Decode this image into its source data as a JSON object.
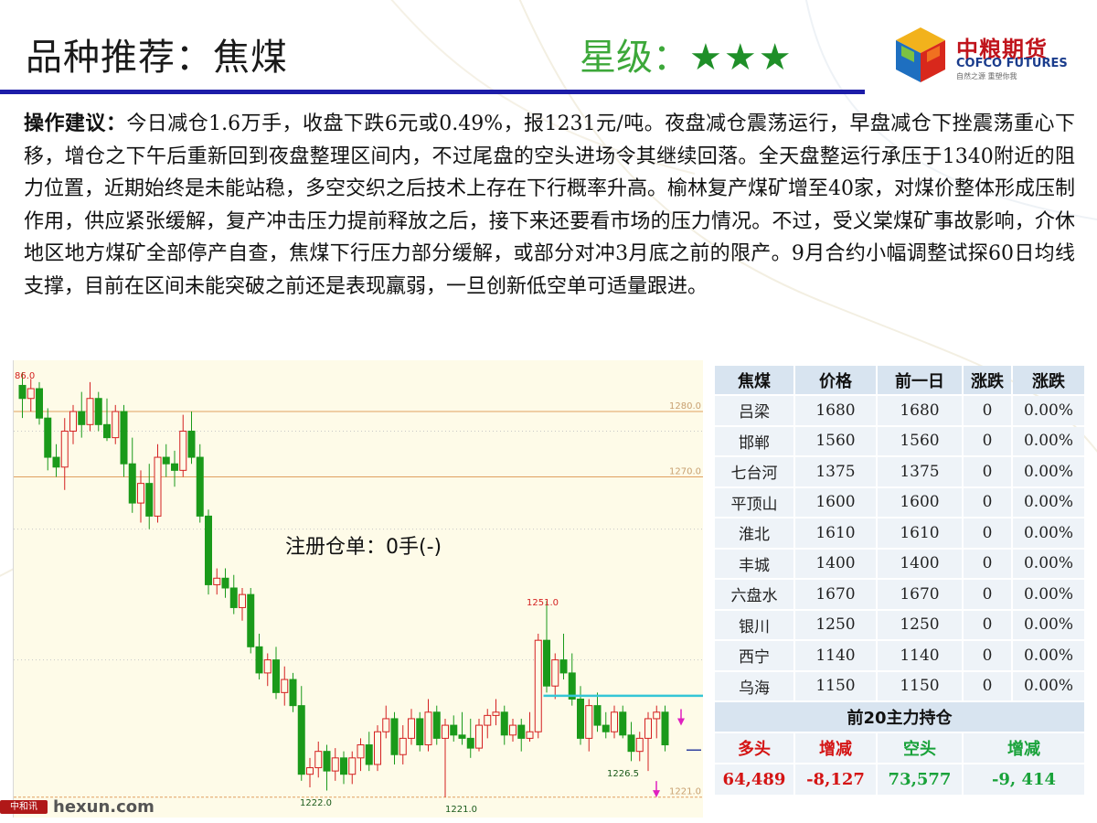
{
  "header": {
    "title": "品种推荐：焦煤",
    "rating_label": "星级：",
    "rating_stars": "★★★",
    "rating_value": 3
  },
  "logo": {
    "cn": "中粮期货",
    "en": "COFCO FUTURES",
    "tagline": "自然之源 重塑你我"
  },
  "advice": {
    "label": "操作建议：",
    "text": "今日减仓1.6万手，收盘下跌6元或0.49%，报1231元/吨。夜盘减仓震荡运行，早盘减仓下挫震荡重心下移，增仓之下午后重新回到夜盘整理区间内，不过尾盘的空头进场令其继续回落。全天盘整运行承压于1340附近的阻力位置，近期始终是未能站稳，多空交织之后技术上存在下行概率升高。榆林复产煤矿增至40家，对煤价整体形成压制作用，供应紧张缓解，复产冲击压力提前释放之后，接下来还要看市场的压力情况。不过，受义棠煤矿事故影响，介休地区地方煤矿全部停产自查，焦煤下行压力部分缓解，或部分对冲3月底之前的限产。9月合约小幅调整试探60日均线支撑，目前在区间未能突破之前还是表现羸弱，一旦创新低空单可适量跟进。"
  },
  "chart_data": {
    "type": "candlestick",
    "annotation": "注册仓单：0手(-)",
    "price_levels": [
      "1280.0",
      "1270.0",
      "1221.0"
    ],
    "price_level_values": [
      1280.0,
      1270.0,
      1221.0
    ],
    "labels": {
      "top_left": "86.0",
      "high": "1251.0",
      "low_right": "1226.5",
      "low_left": "1222.0",
      "low_mid": "1221.0"
    },
    "ylim": [
      1219,
      1287
    ],
    "colors": {
      "up": "#d42020",
      "down": "#1a9a1a",
      "level": "#e0a060",
      "line": "#35c6d6",
      "arrow": "#e020c0",
      "label": "#d42020"
    },
    "candles": [
      [
        1284,
        1286,
        1279,
        1282
      ],
      [
        1282,
        1285,
        1280,
        1283.5
      ],
      [
        1283.5,
        1284.5,
        1278,
        1279
      ],
      [
        1279,
        1280.5,
        1271,
        1273
      ],
      [
        1273,
        1275,
        1270,
        1271.5
      ],
      [
        1271.5,
        1279,
        1268,
        1277
      ],
      [
        1277,
        1281,
        1275,
        1280
      ],
      [
        1280,
        1283,
        1276,
        1278
      ],
      [
        1278,
        1284.5,
        1277,
        1282
      ],
      [
        1282,
        1283,
        1277,
        1278
      ],
      [
        1278,
        1282,
        1275.5,
        1276
      ],
      [
        1276,
        1281,
        1275,
        1280
      ],
      [
        1280,
        1281,
        1270,
        1272
      ],
      [
        1272,
        1276,
        1264.5,
        1266
      ],
      [
        1266,
        1271,
        1263,
        1269
      ],
      [
        1269,
        1272,
        1262,
        1264
      ],
      [
        1264,
        1275,
        1263,
        1273
      ],
      [
        1273,
        1275,
        1270,
        1272
      ],
      [
        1272,
        1274,
        1268.5,
        1271
      ],
      [
        1271,
        1279.5,
        1270,
        1277
      ],
      [
        1277,
        1280,
        1272,
        1273
      ],
      [
        1273,
        1275,
        1263,
        1264
      ],
      [
        1264,
        1265,
        1252,
        1253.5
      ],
      [
        1253.5,
        1256,
        1252,
        1254.5
      ],
      [
        1254.5,
        1256,
        1251.5,
        1253
      ],
      [
        1253,
        1255,
        1249,
        1250
      ],
      [
        1250,
        1253,
        1248,
        1252
      ],
      [
        1252,
        1253,
        1243,
        1244
      ],
      [
        1244,
        1246,
        1239,
        1240
      ],
      [
        1240,
        1243,
        1238,
        1242
      ],
      [
        1242,
        1244,
        1236,
        1237
      ],
      [
        1237,
        1241,
        1235,
        1239
      ],
      [
        1239,
        1240,
        1234,
        1235
      ],
      [
        1235,
        1238,
        1223.5,
        1224.5
      ],
      [
        1224.5,
        1227,
        1222.5,
        1225.5
      ],
      [
        1225.5,
        1229.5,
        1224,
        1228
      ],
      [
        1228,
        1229,
        1222,
        1225
      ],
      [
        1225,
        1228.5,
        1223.5,
        1227
      ],
      [
        1227,
        1228,
        1223,
        1224.5
      ],
      [
        1224.5,
        1228,
        1223,
        1227
      ],
      [
        1227,
        1230,
        1225,
        1229
      ],
      [
        1229,
        1231,
        1225,
        1226
      ],
      [
        1226,
        1232,
        1225,
        1231
      ],
      [
        1231,
        1235,
        1230,
        1233
      ],
      [
        1233,
        1234,
        1226,
        1227.5
      ],
      [
        1227.5,
        1232,
        1226,
        1230
      ],
      [
        1230,
        1234.5,
        1229,
        1233
      ],
      [
        1233,
        1234,
        1228,
        1229
      ],
      [
        1229,
        1236,
        1228,
        1234
      ],
      [
        1234,
        1235,
        1229,
        1230
      ],
      [
        1230,
        1233,
        1221,
        1232
      ],
      [
        1232,
        1233.5,
        1229.5,
        1230.5
      ],
      [
        1230.5,
        1234,
        1229,
        1230
      ],
      [
        1230,
        1233,
        1227,
        1228.5
      ],
      [
        1228.5,
        1233,
        1228,
        1232
      ],
      [
        1232,
        1234.5,
        1230,
        1233.5
      ],
      [
        1233.5,
        1236,
        1232,
        1234
      ],
      [
        1234,
        1235,
        1229,
        1230.5
      ],
      [
        1230.5,
        1233,
        1229.5,
        1232
      ],
      [
        1232,
        1233,
        1228,
        1230
      ],
      [
        1230,
        1234,
        1229.5,
        1231
      ],
      [
        1231,
        1246,
        1230,
        1245
      ],
      [
        1245,
        1251,
        1237,
        1238
      ],
      [
        1238,
        1243,
        1236,
        1242
      ],
      [
        1242,
        1246,
        1239,
        1240
      ],
      [
        1240,
        1243,
        1235,
        1236
      ],
      [
        1236,
        1238,
        1229,
        1230
      ],
      [
        1230,
        1236,
        1228,
        1235
      ],
      [
        1235,
        1237,
        1231,
        1232
      ],
      [
        1232,
        1234,
        1230,
        1231
      ],
      [
        1231,
        1235,
        1230,
        1234
      ],
      [
        1234,
        1235,
        1230,
        1230.5
      ],
      [
        1230.5,
        1232.5,
        1226.5,
        1228
      ],
      [
        1228,
        1231,
        1226.5,
        1230
      ],
      [
        1230,
        1234,
        1225,
        1233
      ],
      [
        1233,
        1235,
        1230,
        1234
      ],
      [
        1234,
        1235,
        1228,
        1229
      ]
    ],
    "resistance_line": 1236.5,
    "arrows_down": [
      1232.5,
      1221.5
    ],
    "dash_mark": 1228.2
  },
  "table": {
    "headers": [
      "焦煤",
      "价格",
      "前一日",
      "涨跌",
      "涨跌"
    ],
    "rows": [
      [
        "吕梁",
        "1680",
        "1680",
        "0",
        "0.00%"
      ],
      [
        "邯郸",
        "1560",
        "1560",
        "0",
        "0.00%"
      ],
      [
        "七台河",
        "1375",
        "1375",
        "0",
        "0.00%"
      ],
      [
        "平顶山",
        "1600",
        "1600",
        "0",
        "0.00%"
      ],
      [
        "淮北",
        "1610",
        "1610",
        "0",
        "0.00%"
      ],
      [
        "丰城",
        "1400",
        "1400",
        "0",
        "0.00%"
      ],
      [
        "六盘水",
        "1670",
        "1670",
        "0",
        "0.00%"
      ],
      [
        "银川",
        "1250",
        "1250",
        "0",
        "0.00%"
      ],
      [
        "西宁",
        "1140",
        "1140",
        "0",
        "0.00%"
      ],
      [
        "乌海",
        "1150",
        "1150",
        "0",
        "0.00%"
      ]
    ]
  },
  "holdings": {
    "caption": "前20主力持仓",
    "headers": [
      "多头",
      "增减",
      "空头",
      "增减"
    ],
    "values": [
      "64,489",
      "-8,127",
      "73,577",
      "-9, 414"
    ]
  },
  "watermark": {
    "badge": "中和讯",
    "text": "hexun.com"
  }
}
